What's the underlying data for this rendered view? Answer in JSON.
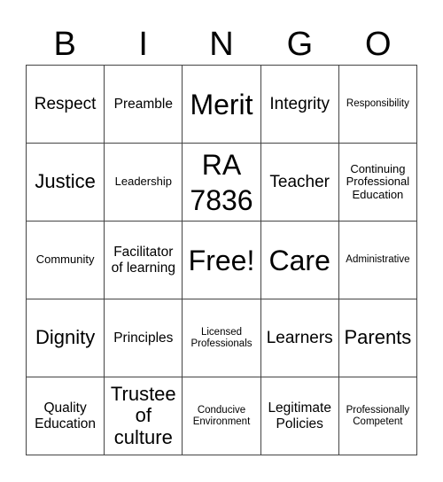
{
  "header": {
    "letters": [
      "B",
      "I",
      "N",
      "G",
      "O"
    ]
  },
  "grid": {
    "cells": [
      {
        "text": "Respect",
        "size": "s-lg"
      },
      {
        "text": "Preamble",
        "size": "s-md"
      },
      {
        "text": "Merit",
        "size": "s-xxl"
      },
      {
        "text": "Integrity",
        "size": "s-lg"
      },
      {
        "text": "Responsibility",
        "size": "s-xs"
      },
      {
        "text": "Justice",
        "size": "s-xl"
      },
      {
        "text": "Leadership",
        "size": "s-sm"
      },
      {
        "text": "RA 7836",
        "size": "s-xxl"
      },
      {
        "text": "Teacher",
        "size": "s-lg"
      },
      {
        "text": "Continuing Professional Education",
        "size": "s-sm"
      },
      {
        "text": "Community",
        "size": "s-sm"
      },
      {
        "text": "Facilitator of learning",
        "size": "s-md"
      },
      {
        "text": "Free!",
        "size": "s-xxl"
      },
      {
        "text": "Care",
        "size": "s-xxl"
      },
      {
        "text": "Administrative",
        "size": "s-xs"
      },
      {
        "text": "Dignity",
        "size": "s-xl"
      },
      {
        "text": "Principles",
        "size": "s-md"
      },
      {
        "text": "Licensed Professionals",
        "size": "s-xs"
      },
      {
        "text": "Learners",
        "size": "s-lg"
      },
      {
        "text": "Parents",
        "size": "s-xl"
      },
      {
        "text": "Quality Education",
        "size": "s-md"
      },
      {
        "text": "Trustee of culture",
        "size": "s-xl"
      },
      {
        "text": "Conducive Environment",
        "size": "s-xs"
      },
      {
        "text": "Legitimate Policies",
        "size": "s-md"
      },
      {
        "text": "Professionally Competent",
        "size": "s-xs"
      }
    ]
  }
}
